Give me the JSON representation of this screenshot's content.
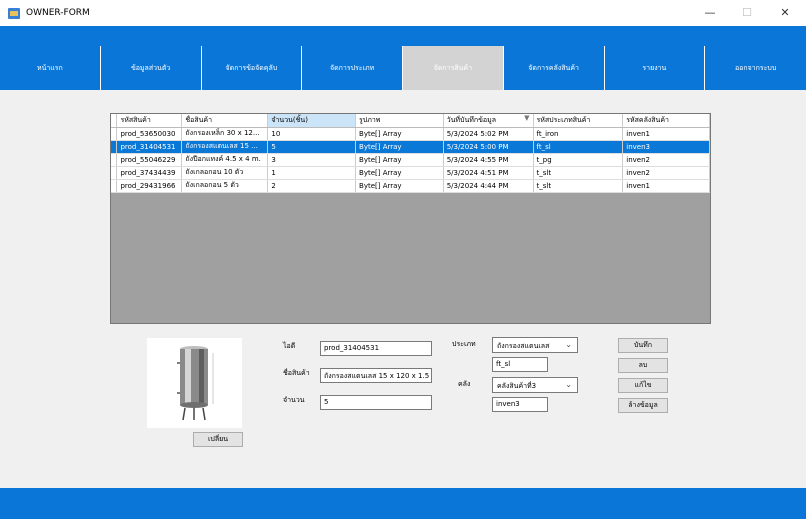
{
  "window": {
    "title": "OWNER-FORM",
    "minimize": "—",
    "maximize": "☐",
    "close": "✕"
  },
  "nav": [
    {
      "label": "หน้าแรก"
    },
    {
      "label": "ข้อมูลส่วนตัว"
    },
    {
      "label": "จัดการข้อจัดคุลับ"
    },
    {
      "label": "จัดการประเภท"
    },
    {
      "label": "จัดการสินค้า",
      "active": true
    },
    {
      "label": "จัดการคลังสินค้า"
    },
    {
      "label": "รายงาน"
    },
    {
      "label": "ออกจากระบบ"
    }
  ],
  "grid": {
    "headers": [
      "รหัสสินค้า",
      "ชื่อสินค้า",
      "จำนวน(ชิ้น)",
      "รูปภาพ",
      "วันที่บันทึกข้อมูล",
      "รหัสประเภทสินค้า",
      "รหัสคลังสินค้า"
    ],
    "sort_indicator": "▼",
    "rows": [
      {
        "cells": [
          "prod_53650030",
          "ถังกรองเหล็ก 30 x 12...",
          "10",
          "Byte[] Array",
          "5/3/2024 5:02 PM",
          "ft_iron",
          "inven1"
        ]
      },
      {
        "cells": [
          "prod_31404531",
          "ถังกรองสแตนเลส 15 ...",
          "5",
          "Byte[] Array",
          "5/3/2024 5:00 PM",
          "ft_sl",
          "inven3"
        ],
        "selected": true
      },
      {
        "cells": [
          "prod_55046229",
          "ถังปีอกแทงค์ 4.5 x 4 m.",
          "3",
          "Byte[] Array",
          "5/3/2024 4:55 PM",
          "t_pg",
          "inven2"
        ]
      },
      {
        "cells": [
          "prod_37434439",
          "ถังเกลอกอน 10 ตัว",
          "1",
          "Byte[] Array",
          "5/3/2024 4:51 PM",
          "t_slt",
          "inven2"
        ]
      },
      {
        "cells": [
          "prod_29431966",
          "ถังเกลอกอน 5 ตัว",
          "2",
          "Byte[] Array",
          "5/3/2024 4:44 PM",
          "t_slt",
          "inven1"
        ]
      }
    ]
  },
  "form": {
    "change_image_label": "เปลี่ยน",
    "id_label": "ไอดี",
    "id_value": "prod_31404531",
    "name_label": "ชื่อสินค้า",
    "name_value": "ถังกรองสแตนเลส 15 x 120 x 1.5",
    "qty_label": "จำนวน",
    "qty_value": "5",
    "type_label": "ประเภท",
    "type_selected": "ถังกรองสแตนเลส",
    "type_code": "ft_sl",
    "store_label": "คลัง",
    "store_selected": "คลังสินค้าที่3",
    "store_code": "inven3",
    "save_label": "บันทึก",
    "delete_label": "ลบ",
    "edit_label": "แก้ไข",
    "clear_label": "ล้างข้อมูล"
  }
}
